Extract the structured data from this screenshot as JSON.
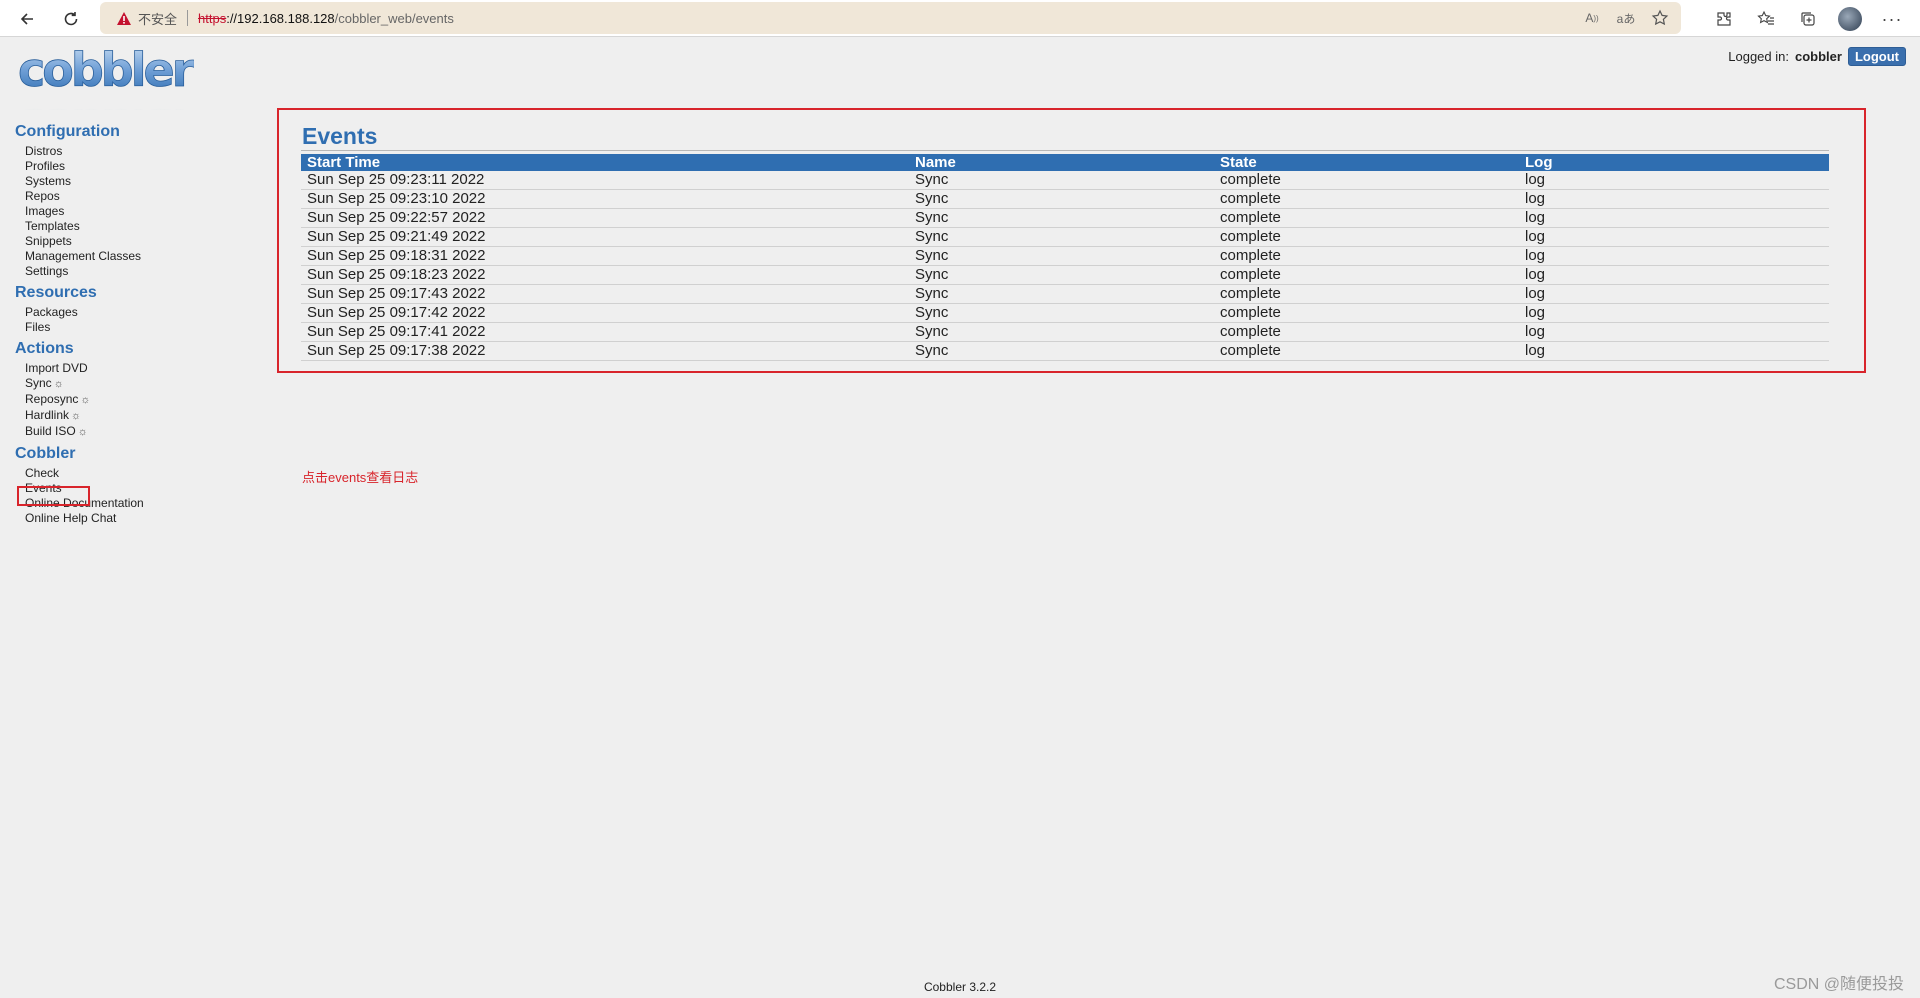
{
  "browser": {
    "insecure_label": "不安全",
    "url_scheme": "https",
    "url_host": "://192.168.188.128",
    "url_path": "/cobbler_web/events"
  },
  "header": {
    "logo_text": "cobbler",
    "logged_in_label": "Logged in:",
    "username": "cobbler",
    "logout_label": "Logout"
  },
  "sidebar": {
    "sections": [
      {
        "title": "Configuration",
        "items": [
          "Distros",
          "Profiles",
          "Systems",
          "Repos",
          "Images",
          "Templates",
          "Snippets",
          "Management Classes",
          "Settings"
        ]
      },
      {
        "title": "Resources",
        "items": [
          "Packages",
          "Files"
        ]
      },
      {
        "title": "Actions",
        "items": [
          "Import DVD",
          "Sync",
          "Reposync",
          "Hardlink",
          "Build ISO"
        ]
      },
      {
        "title": "Cobbler",
        "items": [
          "Check",
          "Events",
          "Online Documentation",
          "Online Help Chat"
        ]
      }
    ]
  },
  "main": {
    "title": "Events",
    "columns": [
      "Start Time",
      "Name",
      "State",
      "Log"
    ],
    "rows": [
      [
        "Sun Sep 25 09:23:11 2022",
        "Sync",
        "complete",
        "log"
      ],
      [
        "Sun Sep 25 09:23:10 2022",
        "Sync",
        "complete",
        "log"
      ],
      [
        "Sun Sep 25 09:22:57 2022",
        "Sync",
        "complete",
        "log"
      ],
      [
        "Sun Sep 25 09:21:49 2022",
        "Sync",
        "complete",
        "log"
      ],
      [
        "Sun Sep 25 09:18:31 2022",
        "Sync",
        "complete",
        "log"
      ],
      [
        "Sun Sep 25 09:18:23 2022",
        "Sync",
        "complete",
        "log"
      ],
      [
        "Sun Sep 25 09:17:43 2022",
        "Sync",
        "complete",
        "log"
      ],
      [
        "Sun Sep 25 09:17:42 2022",
        "Sync",
        "complete",
        "log"
      ],
      [
        "Sun Sep 25 09:17:41 2022",
        "Sync",
        "complete",
        "log"
      ],
      [
        "Sun Sep 25 09:17:38 2022",
        "Sync",
        "complete",
        "log"
      ]
    ],
    "annotation": "点击events查看日志"
  },
  "footer": {
    "version": "Cobbler 3.2.2",
    "watermark": "CSDN @随便投投"
  },
  "colors": {
    "accent": "#2f6eb1",
    "highlight_red": "#d8242b"
  }
}
